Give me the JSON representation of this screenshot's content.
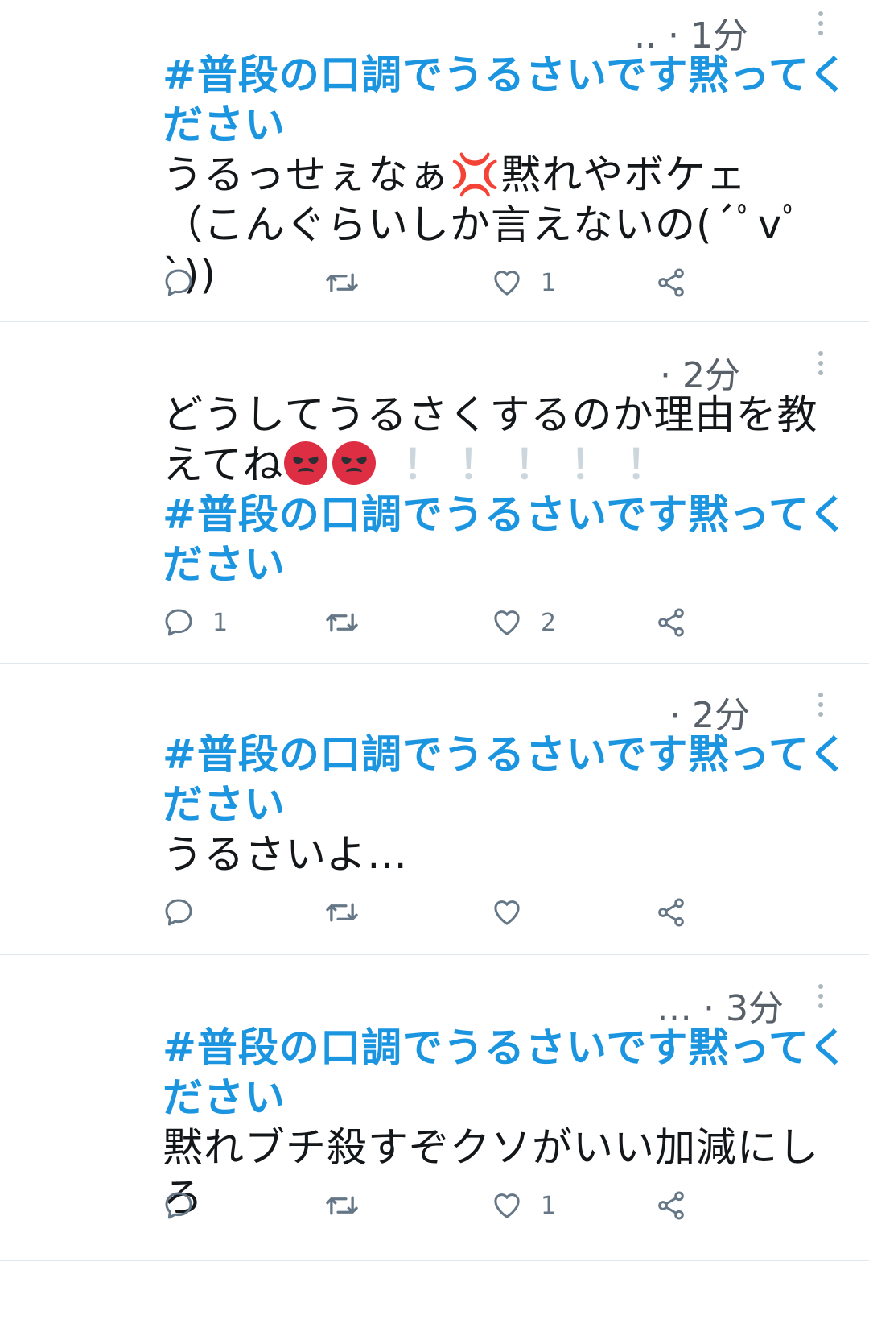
{
  "tweets": [
    {
      "meta": ".. · 1分",
      "hashtag": "#普段の口調でうるさいです黙ってください",
      "text_before": "",
      "text_after": "うるっせぇなぁ💢黙れやボケェ\n（こんぐらいしか言えないの(´ﾟvﾟ`))",
      "reply_count": "",
      "like_count": "1"
    },
    {
      "meta": "· 2分",
      "text_before": "どうしてうるさくするのか理由を教えてね",
      "exclamations": "！ ！ ！ ！ ！",
      "hashtag": "#普段の口調でうるさいです黙ってください",
      "text_after": "",
      "reply_count": "1",
      "like_count": "2"
    },
    {
      "meta": "· 2分",
      "hashtag": "#普段の口調でうるさいです黙ってください",
      "text_before": "",
      "text_after": "うるさいよ…",
      "reply_count": "",
      "like_count": ""
    },
    {
      "meta": "… · 3分",
      "hashtag": "#普段の口調でうるさいです黙ってください",
      "text_before": "",
      "text_after": "黙れブチ殺すぞクソがいい加減にしろ",
      "reply_count": "",
      "like_count": "1"
    }
  ],
  "icons": {
    "reply": "reply-icon",
    "retweet": "retweet-icon",
    "like": "heart-icon",
    "share": "share-icon",
    "more": "more-vertical-icon",
    "angry_face": "angry-face-emoji",
    "anger_symbol": "anger-symbol-emoji"
  },
  "colors": {
    "hashtag": "#1b95e0",
    "icon": "#657786",
    "divider": "#e1e8ed"
  }
}
